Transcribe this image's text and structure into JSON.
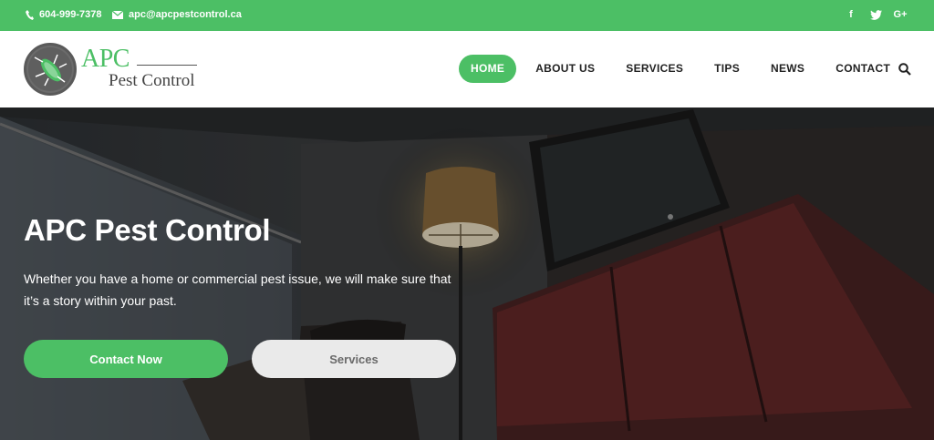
{
  "topbar": {
    "phone": "604-999-7378",
    "email": "apc@apcpestcontrol.ca",
    "social": [
      {
        "icon": "facebook-icon",
        "glyph": "f"
      },
      {
        "icon": "twitter-icon",
        "glyph": "t"
      },
      {
        "icon": "google-plus-icon",
        "glyph": "G+"
      }
    ],
    "color": "#4cbf65"
  },
  "logo": {
    "top": "APC",
    "bottom": "Pest Control"
  },
  "nav": {
    "items": [
      {
        "label": "HOME",
        "active": true
      },
      {
        "label": "ABOUT US",
        "active": false
      },
      {
        "label": "SERVICES",
        "active": false
      },
      {
        "label": "TIPS",
        "active": false
      },
      {
        "label": "NEWS",
        "active": false
      },
      {
        "label": "CONTACT",
        "active": false
      }
    ],
    "search_icon": "search-icon"
  },
  "hero": {
    "title": "APC Pest Control",
    "subtitle": "Whether you have a home or commercial pest issue, we will make sure that it’s a story within your past.",
    "primary_button": "Contact Now",
    "secondary_button": "Services"
  },
  "colors": {
    "accent": "#4cbf65",
    "secondary_button_bg": "#eaeaea"
  }
}
